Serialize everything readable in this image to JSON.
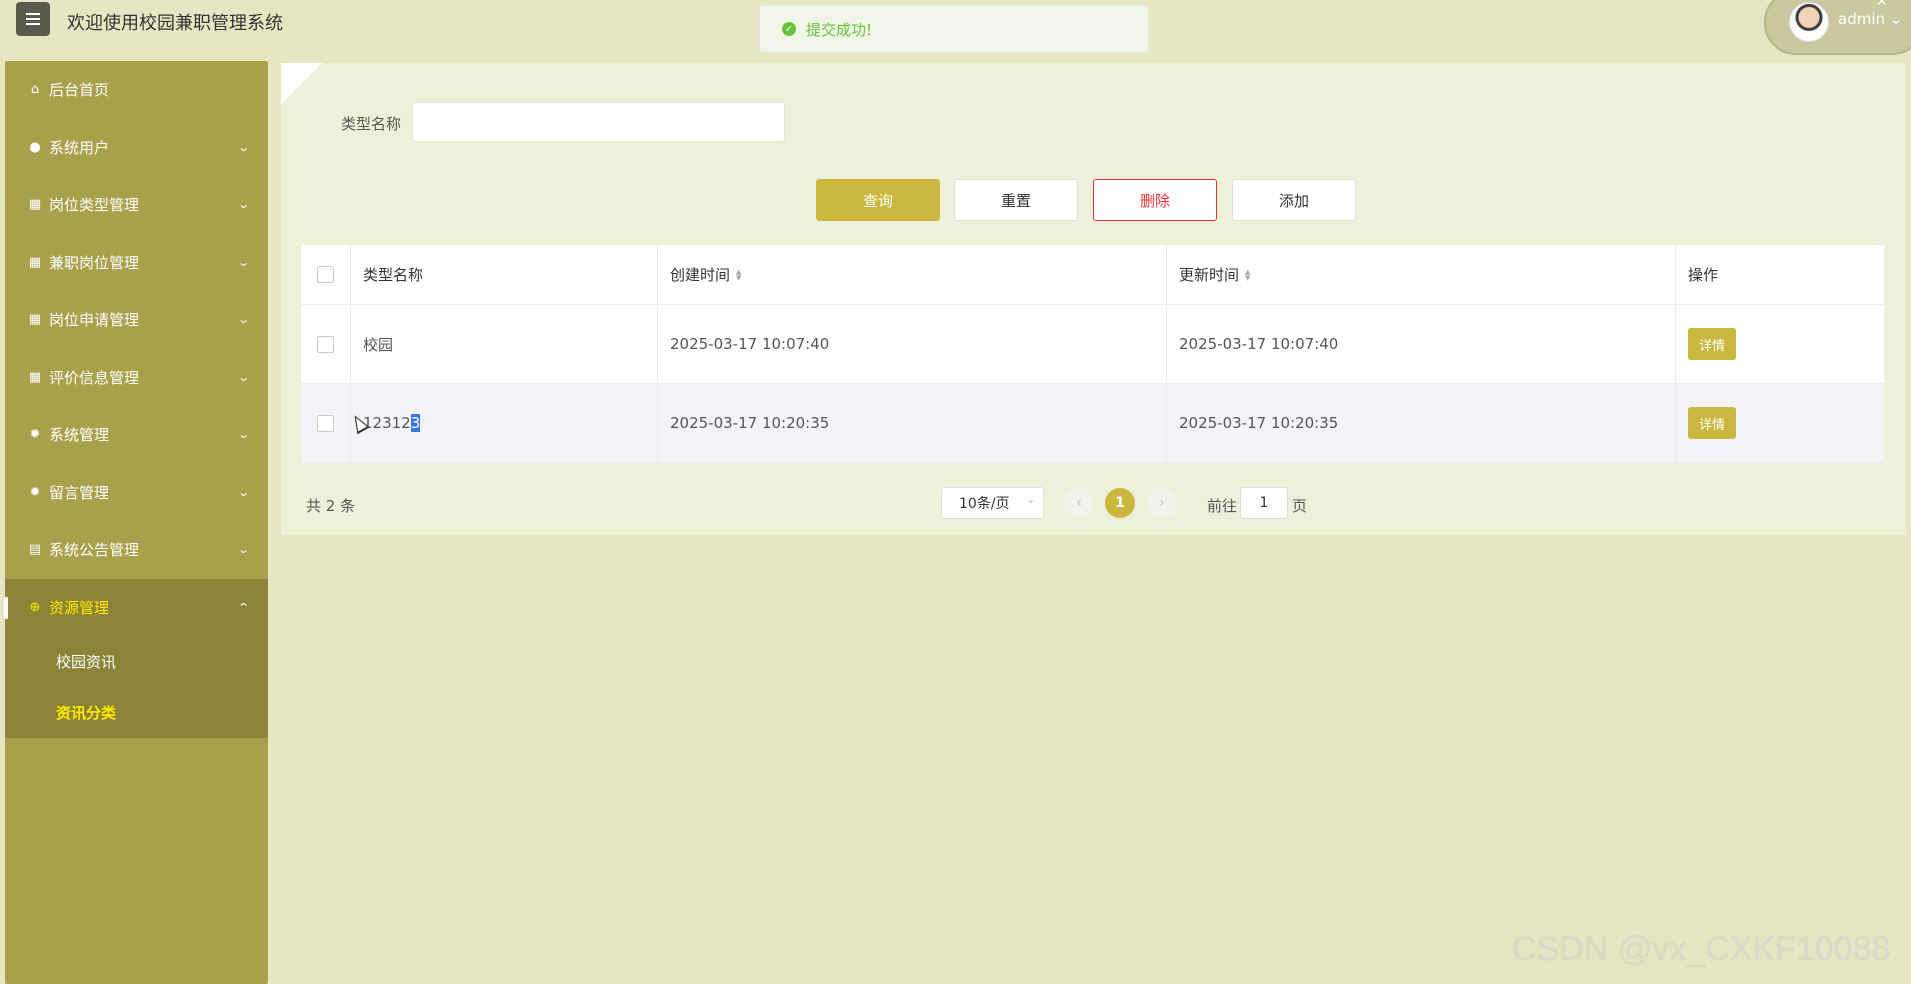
{
  "app_title": "欢迎使用校园兼职管理系统",
  "toast": {
    "message": "提交成功!"
  },
  "user": {
    "name": "admin"
  },
  "sidebar": {
    "items": [
      {
        "label": "后台首页",
        "icon": "home-icon"
      },
      {
        "label": "系统用户",
        "icon": "user-icon"
      },
      {
        "label": "岗位类型管理",
        "icon": "grid-icon"
      },
      {
        "label": "兼职岗位管理",
        "icon": "grid-icon"
      },
      {
        "label": "岗位申请管理",
        "icon": "grid-icon"
      },
      {
        "label": "评价信息管理",
        "icon": "grid-icon"
      },
      {
        "label": "系统管理",
        "icon": "gear-icon"
      },
      {
        "label": "留言管理",
        "icon": "gear-icon"
      },
      {
        "label": "系统公告管理",
        "icon": "doc-icon"
      },
      {
        "label": "资源管理",
        "icon": "plus-circle-icon"
      }
    ],
    "subitems": [
      {
        "label": "校园资讯"
      },
      {
        "label": "资讯分类"
      }
    ]
  },
  "filter": {
    "label": "类型名称",
    "value": ""
  },
  "buttons": {
    "query": "查询",
    "reset": "重置",
    "delete": "删除",
    "add": "添加"
  },
  "table": {
    "headers": {
      "name": "类型名称",
      "created": "创建时间",
      "updated": "更新时间",
      "action": "操作"
    },
    "rows": [
      {
        "name": "校园",
        "created": "2025-03-17 10:07:40",
        "updated": "2025-03-17 10:07:40",
        "action": "详情"
      },
      {
        "name_prefix": "12312",
        "name_selected": "3",
        "created": "2025-03-17 10:20:35",
        "updated": "2025-03-17 10:20:35",
        "action": "详情"
      }
    ]
  },
  "pagination": {
    "total": "共 2 条",
    "page_size": "10条/页",
    "current_page": "1",
    "goto_label": "前往",
    "goto_value": "1",
    "goto_unit": "页"
  },
  "watermark": "CSDN @vx_CXKF10088",
  "colors": {
    "accent": "#c9b73e",
    "sidebar": "#a9a04b",
    "active_text": "#ffea00",
    "danger": "#e33"
  }
}
